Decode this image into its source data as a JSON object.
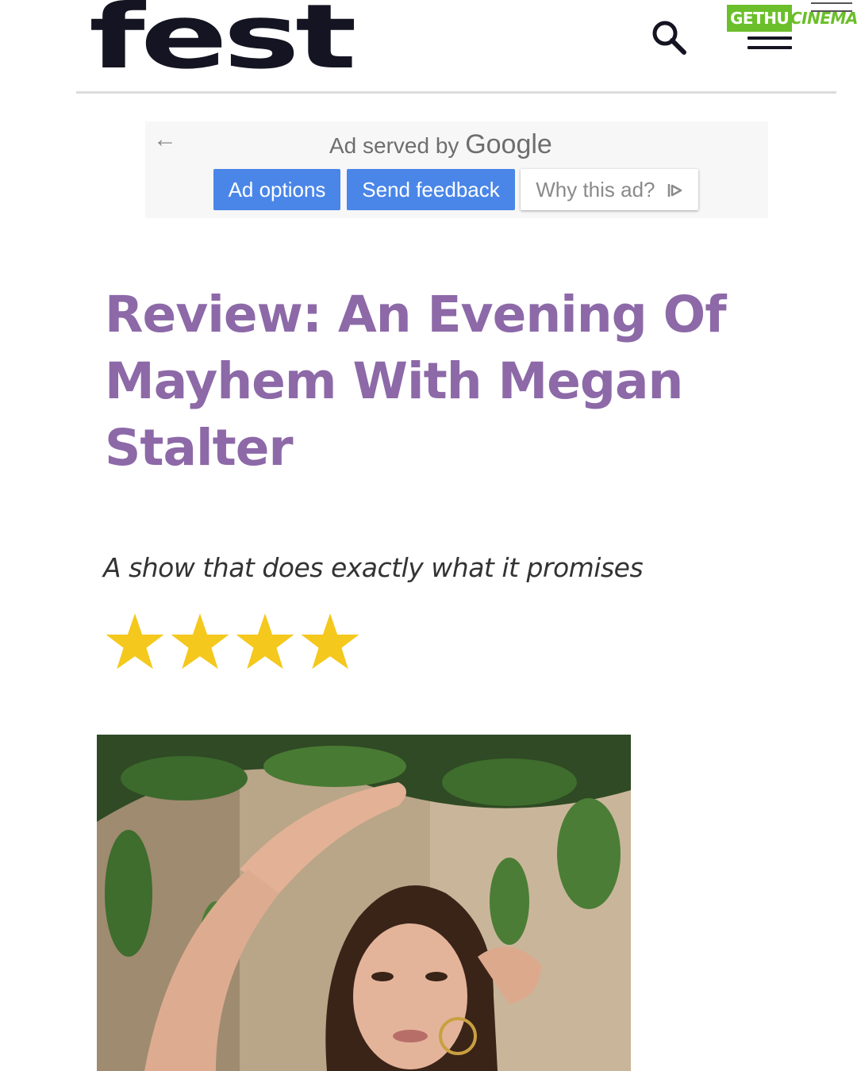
{
  "header": {
    "logo_text": "fest",
    "search_icon": "search-icon",
    "menu_icon": "hamburger-menu-icon",
    "watermark": {
      "left": "GETHU",
      "right": "CINEMA"
    }
  },
  "ad": {
    "back_icon": "arrow-left-icon",
    "served_by": "Ad served by",
    "brand": "Google",
    "ad_options": "Ad options",
    "send_feedback": "Send feedback",
    "why_this_ad": "Why this ad?",
    "why_icon": "adchoices-icon"
  },
  "article": {
    "title": "Review: An Evening Of Mayhem With Megan Stalter",
    "subtitle": "A show that does exactly what it promises",
    "rating": {
      "value": 4,
      "max": 4
    }
  },
  "colors": {
    "title": "#8d69a8",
    "star": "#f4c81c",
    "ad_button": "#4a86e8",
    "logo": "#141422",
    "watermark": "#6bbf2a"
  }
}
